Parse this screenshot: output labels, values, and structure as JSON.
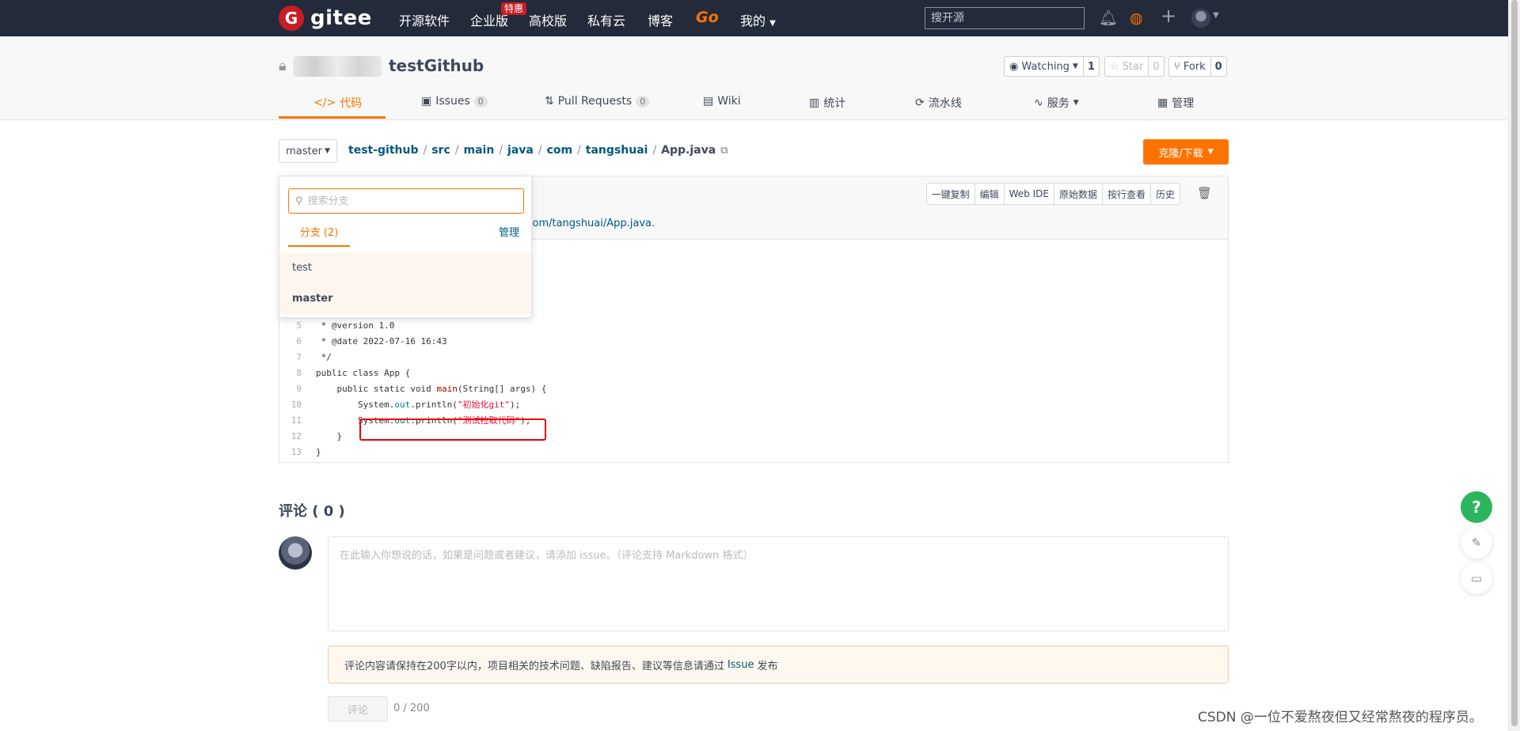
{
  "nav": {
    "logo_mark": "G",
    "logo_text": "gitee",
    "items": [
      "开源软件",
      "企业版",
      "高校版",
      "私有云",
      "博客"
    ],
    "hot_badge": "特惠",
    "go_label": "Go",
    "mine_label": "我的",
    "search_placeholder": "搜开源"
  },
  "repo": {
    "name": "testGithub",
    "watch_label": "Watching",
    "watch_count": "1",
    "star_label": "Star",
    "star_count": "0",
    "fork_label": "Fork",
    "fork_count": "0"
  },
  "tabs": [
    {
      "label": "代码"
    },
    {
      "label": "Issues",
      "count": "0"
    },
    {
      "label": "Pull Requests",
      "count": "0"
    },
    {
      "label": "Wiki"
    },
    {
      "label": "统计"
    },
    {
      "label": "流水线"
    },
    {
      "label": "服务"
    },
    {
      "label": "管理"
    }
  ],
  "path": {
    "branch": "master",
    "crumbs": [
      "test-github",
      "src",
      "main",
      "java",
      "com",
      "tangshuai"
    ],
    "file": "App.java",
    "clone_label": "克隆/下载"
  },
  "file": {
    "commit_msg": "a/com/tangshuai/App.java.",
    "tools": [
      "一键复制",
      "编辑",
      "Web IDE",
      "原始数据",
      "按行查看",
      "历史"
    ]
  },
  "code_lines": [
    {
      "n": "5",
      "text": " * @version 1.0"
    },
    {
      "n": "6",
      "text": " * @date 2022-07-16 16:43"
    },
    {
      "n": "7",
      "text": " */"
    },
    {
      "n": "8",
      "text": "public class App {"
    },
    {
      "n": "9",
      "pre": "    public static void ",
      "fn": "main",
      "post": "(String[] args) {"
    },
    {
      "n": "10",
      "pre": "        System.",
      "field": "out",
      "mid": ".println(",
      "str": "\"初始化git\"",
      "post": ");"
    },
    {
      "n": "11",
      "pre": "        System.",
      "field": "out",
      "mid": ".println(",
      "str": "\"测试拉取代码\"",
      "post": ");"
    },
    {
      "n": "12",
      "text": "    }"
    },
    {
      "n": "13",
      "text": "}"
    }
  ],
  "branch_dropdown": {
    "search_placeholder": "搜索分支",
    "tab_label": "分支 (2)",
    "manage_label": "管理",
    "branches": [
      "test",
      "master"
    ]
  },
  "comments": {
    "title": "评论 ( 0 )",
    "placeholder": "在此输入你想说的话，如果是问题或者建议，请添加 issue。（评论支持 Markdown 格式）",
    "notice_pre": "评论内容请保持在200字以内，项目相关的技术问题、缺陷报告、建议等信息请通过",
    "notice_link": "Issue",
    "notice_post": "发布",
    "submit_label": "评论",
    "char_count": "0 / 200"
  },
  "floating": {
    "help": "?"
  },
  "watermark": "CSDN @一位不爱熬夜但又经常熬夜的程序员。"
}
